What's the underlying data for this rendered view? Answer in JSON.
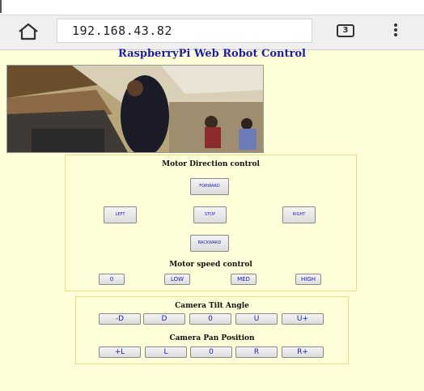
{
  "browser": {
    "address": "192.168.43.82",
    "tab_count": "3"
  },
  "page": {
    "title": "RaspberryPi Web Robot Control"
  },
  "motor": {
    "heading": "Motor Direction control",
    "forward": "FORWARD",
    "left": "LEFT",
    "stop": "STOP",
    "right": "RIGHT",
    "backward": "BACKWARD"
  },
  "speed": {
    "heading": "Motor speed control",
    "zero": "0",
    "low": "LOW",
    "med": "MED",
    "high": "HIGH"
  },
  "tilt": {
    "heading": "Camera Tilt Angle",
    "buttons": [
      "-D",
      "D",
      "0",
      "U",
      "U+"
    ]
  },
  "pan": {
    "heading": "Camera Pan Position",
    "buttons": [
      "+L",
      "L",
      "0",
      "R",
      "R+"
    ]
  }
}
